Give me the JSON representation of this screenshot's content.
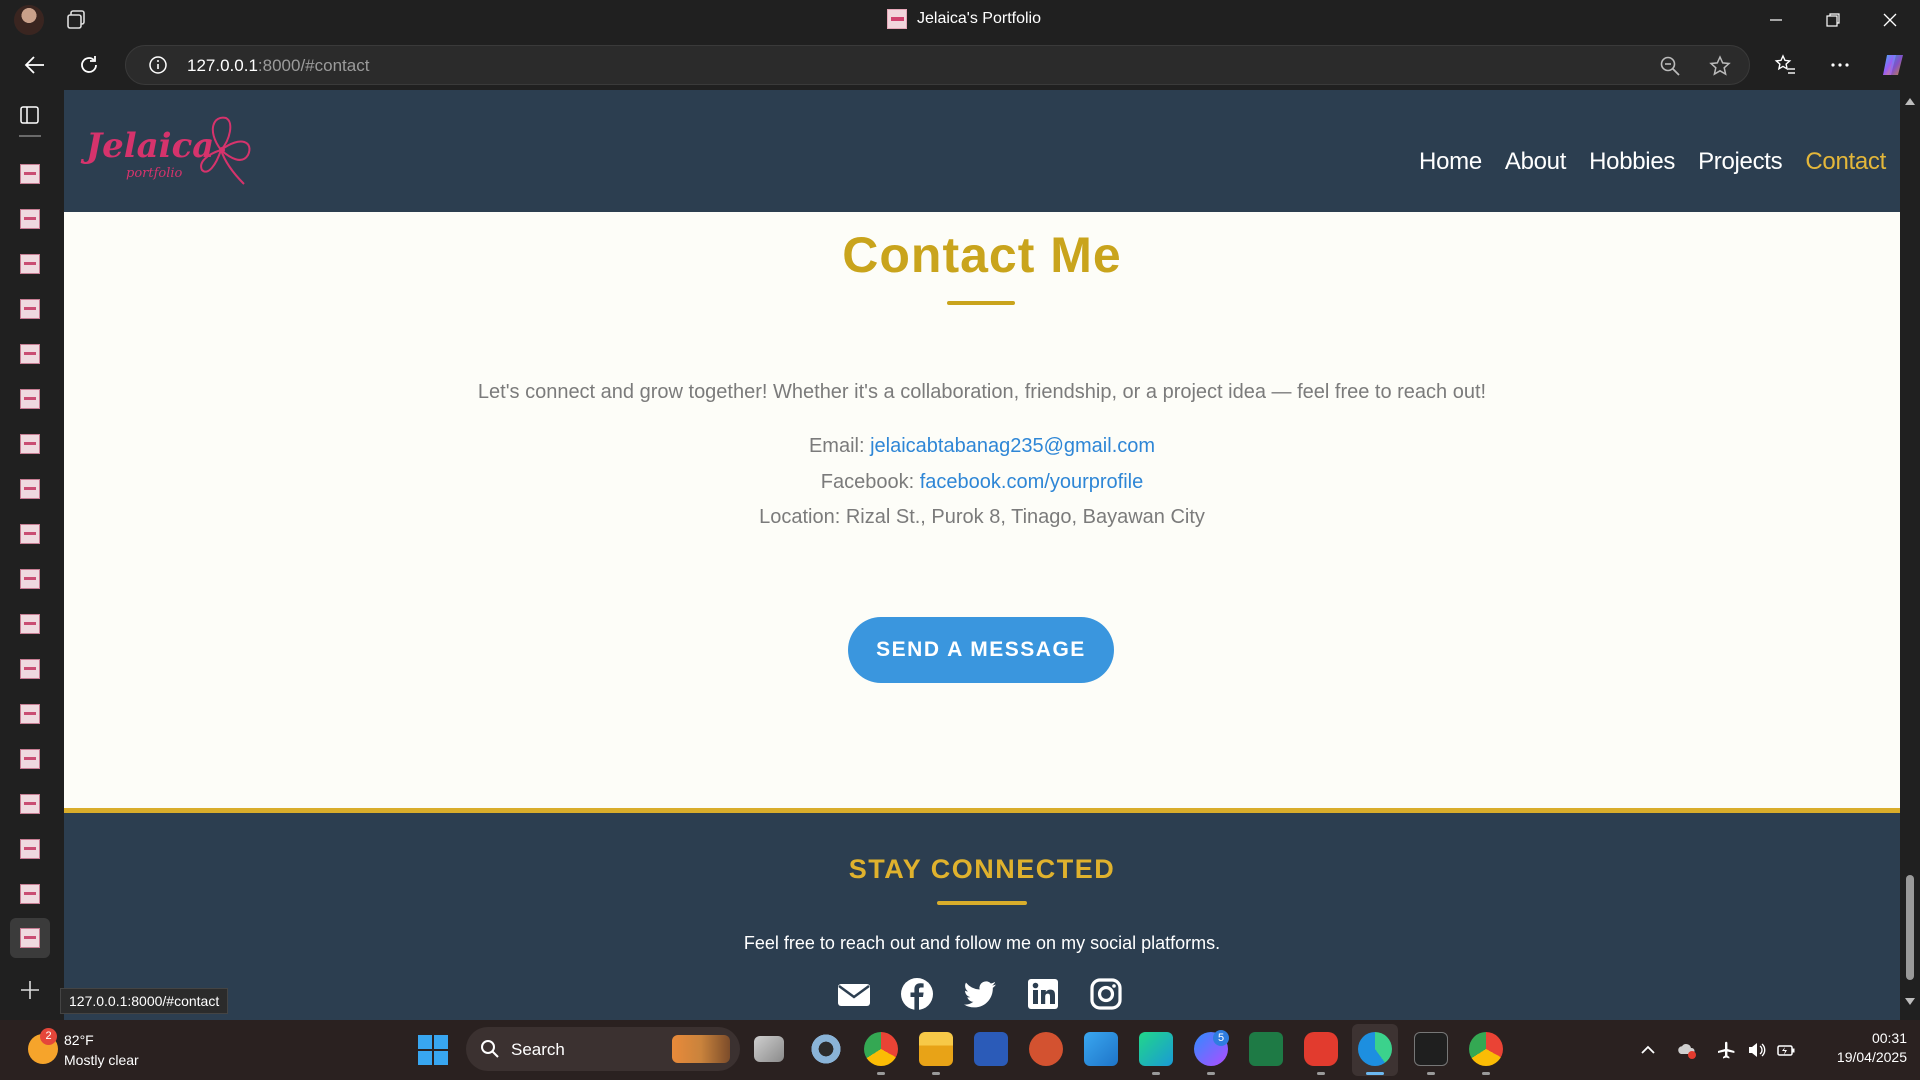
{
  "browser": {
    "window_title": "Jelaica's Portfolio",
    "url_host": "127.0.0.1",
    "url_rest": ":8000/#contact",
    "status_url": "127.0.0.1:8000/#contact"
  },
  "site": {
    "logo_text": "Jelaica",
    "logo_sub": "portfolio",
    "nav": [
      {
        "label": "Home"
      },
      {
        "label": "About"
      },
      {
        "label": "Hobbies"
      },
      {
        "label": "Projects"
      },
      {
        "label": "Contact",
        "active": true
      }
    ]
  },
  "contact": {
    "title": "Contact Me",
    "intro": "Let's connect and grow together! Whether it's a collaboration, friendship, or a project idea — feel free to reach out!",
    "email_label": "Email:",
    "email_value": "jelaicabtabanag235@gmail.com",
    "facebook_label": "Facebook:",
    "facebook_value": "facebook.com/yourprofile",
    "location": "Location: Rizal St., Purok 8, Tinago, Bayawan City",
    "button": "SEND A MESSAGE"
  },
  "footer": {
    "title": "STAY CONNECTED",
    "text": "Feel free to reach out and follow me on my social platforms.",
    "socials": [
      "envelope-icon",
      "facebook-icon",
      "twitter-icon",
      "linkedin-icon",
      "instagram-icon"
    ]
  },
  "taskbar": {
    "weather_temp": "82°F",
    "weather_desc": "Mostly clear",
    "weather_badge": "2",
    "search_label": "Search",
    "messenger_badge": "5",
    "time": "00:31",
    "date": "19/04/2025"
  },
  "colors": {
    "accent_gold": "#c9a41c",
    "nav_bg": "#2c3e50",
    "link_blue": "#2e86d6",
    "button_blue": "#3a96de",
    "logo_pink": "#d6336c"
  }
}
